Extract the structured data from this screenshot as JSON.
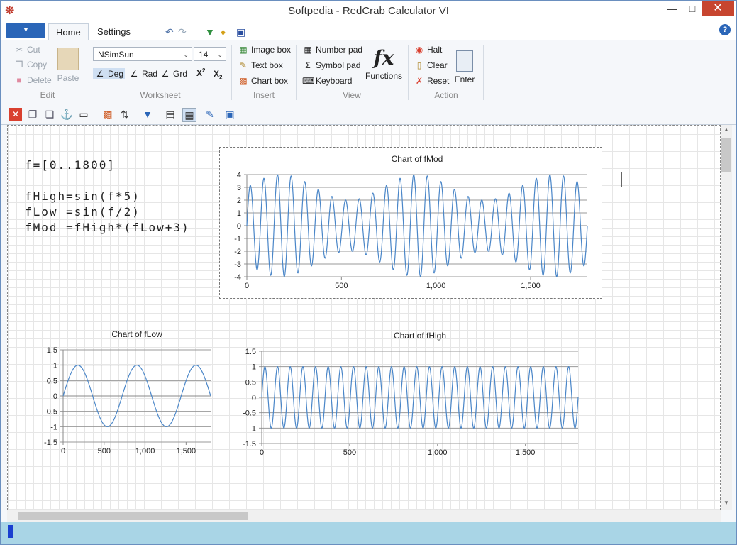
{
  "window": {
    "title": "Softpedia - RedCrab Calculator VI"
  },
  "tabs": [
    {
      "label": "Home"
    },
    {
      "label": "Settings"
    }
  ],
  "ribbon": {
    "edit": {
      "cut": "Cut",
      "copy": "Copy",
      "delete": "Delete",
      "paste": "Paste",
      "group": "Edit"
    },
    "worksheet": {
      "font": "NSimSun",
      "size": "14",
      "deg": "Deg",
      "rad": "Rad",
      "grd": "Grd",
      "group": "Worksheet"
    },
    "insert": {
      "image_box": "Image box",
      "text_box": "Text box",
      "chart_box": "Chart box",
      "group": "Insert"
    },
    "view": {
      "number_pad": "Number pad",
      "symbol_pad": "Symbol pad",
      "keyboard": "Keyboard",
      "functions": "Functions",
      "functions_glyph": "fx",
      "group": "View"
    },
    "action": {
      "halt": "Halt",
      "clear": "Clear",
      "reset": "Reset",
      "enter": "Enter",
      "group": "Action"
    }
  },
  "worksheet": {
    "lines": [
      "f=[0..1800]",
      "fHigh=sin(f*5)",
      "fLow =sin(f/2)",
      "fMod =fHigh*(fLow+3)"
    ]
  },
  "chart_data": [
    {
      "type": "line",
      "title": "Chart of fMod",
      "x_range": [
        0,
        1800
      ],
      "ylim": [
        -4,
        4
      ],
      "yticks": [
        4,
        3,
        2,
        1,
        0,
        -1,
        -2,
        -3,
        -4
      ],
      "xticks": [
        0,
        500,
        1000,
        1500
      ],
      "xtick_labels": [
        "0",
        "500",
        "1,000",
        "1,500"
      ],
      "formula": "sin(x*5)*(sin(x/2)+3)",
      "color": "#4a86c8"
    },
    {
      "type": "line",
      "title": "Chart of fLow",
      "x_range": [
        0,
        1800
      ],
      "ylim": [
        -1.5,
        1.5
      ],
      "yticks": [
        1.5,
        1,
        0.5,
        0,
        -0.5,
        -1,
        -1.5
      ],
      "xticks": [
        0,
        500,
        1000,
        1500
      ],
      "xtick_labels": [
        "0",
        "500",
        "1,000",
        "1,500"
      ],
      "formula": "sin(x/2)",
      "color": "#4a86c8"
    },
    {
      "type": "line",
      "title": "Chart of fHigh",
      "x_range": [
        0,
        1800
      ],
      "ylim": [
        -1.5,
        1.5
      ],
      "yticks": [
        1.5,
        1,
        0.5,
        0,
        -0.5,
        -1,
        -1.5
      ],
      "xticks": [
        0,
        500,
        1000,
        1500
      ],
      "xtick_labels": [
        "0",
        "500",
        "1,000",
        "1,500"
      ],
      "formula": "sin(x*5)",
      "color": "#4a86c8"
    }
  ]
}
